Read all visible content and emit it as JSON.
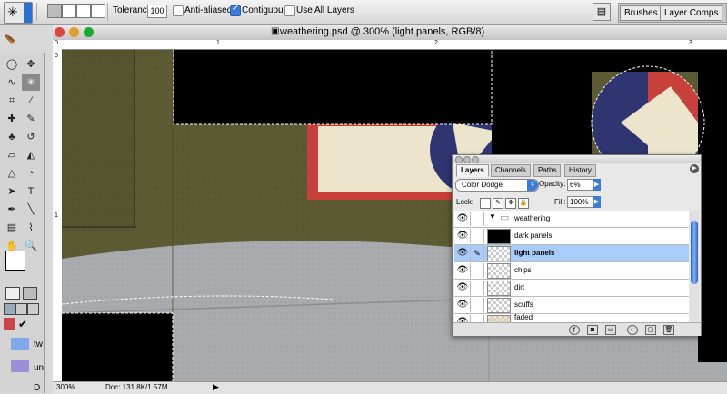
{
  "options_bar": {
    "tolerance_label": "Tolerance:",
    "tolerance_value": "100",
    "anti_aliased_label": "Anti-aliased",
    "anti_aliased_checked": false,
    "contiguous_label": "Contiguous",
    "contiguous_checked": true,
    "use_all_layers_label": "Use All Layers",
    "use_all_layers_checked": false,
    "palette_well_tabs": [
      "Brushes",
      "Layer Comps"
    ]
  },
  "document": {
    "title": "weathering.psd @ 300% (light panels, RGB/8)",
    "ruler_marks": [
      "0",
      "1",
      "2",
      "3"
    ]
  },
  "status_bar": {
    "zoom": "300%",
    "doc_size": "Doc: 131.8K/1.57M"
  },
  "layers_panel": {
    "tabs": [
      "Layers",
      "Channels",
      "Paths",
      "History"
    ],
    "active_tab": "Layers",
    "blend_mode": "Color Dodge",
    "opacity_label": "Opacity:",
    "opacity_value": "6%",
    "lock_label": "Lock:",
    "fill_label": "Fill:",
    "fill_value": "100%",
    "group_name": "weathering",
    "layers": [
      {
        "name": "dark panels",
        "visible": true,
        "selected": false
      },
      {
        "name": "light panels",
        "visible": true,
        "selected": true
      },
      {
        "name": "chips",
        "visible": true,
        "selected": false
      },
      {
        "name": "dirt",
        "visible": true,
        "selected": false
      },
      {
        "name": "scuffs",
        "visible": true,
        "selected": false
      },
      {
        "name": "faded",
        "visible": true,
        "selected": false
      }
    ]
  },
  "desktop": {
    "folder_labels": [
      "tw",
      "un",
      "D"
    ]
  },
  "colors": {
    "accent": "#3d7bd9",
    "olive_paint": "#5c5a32",
    "grey_paint": "#a8abae",
    "roundel_blue": "#2e3570",
    "roundel_red": "#c8403a",
    "selected_row": "#a9cdfb"
  }
}
